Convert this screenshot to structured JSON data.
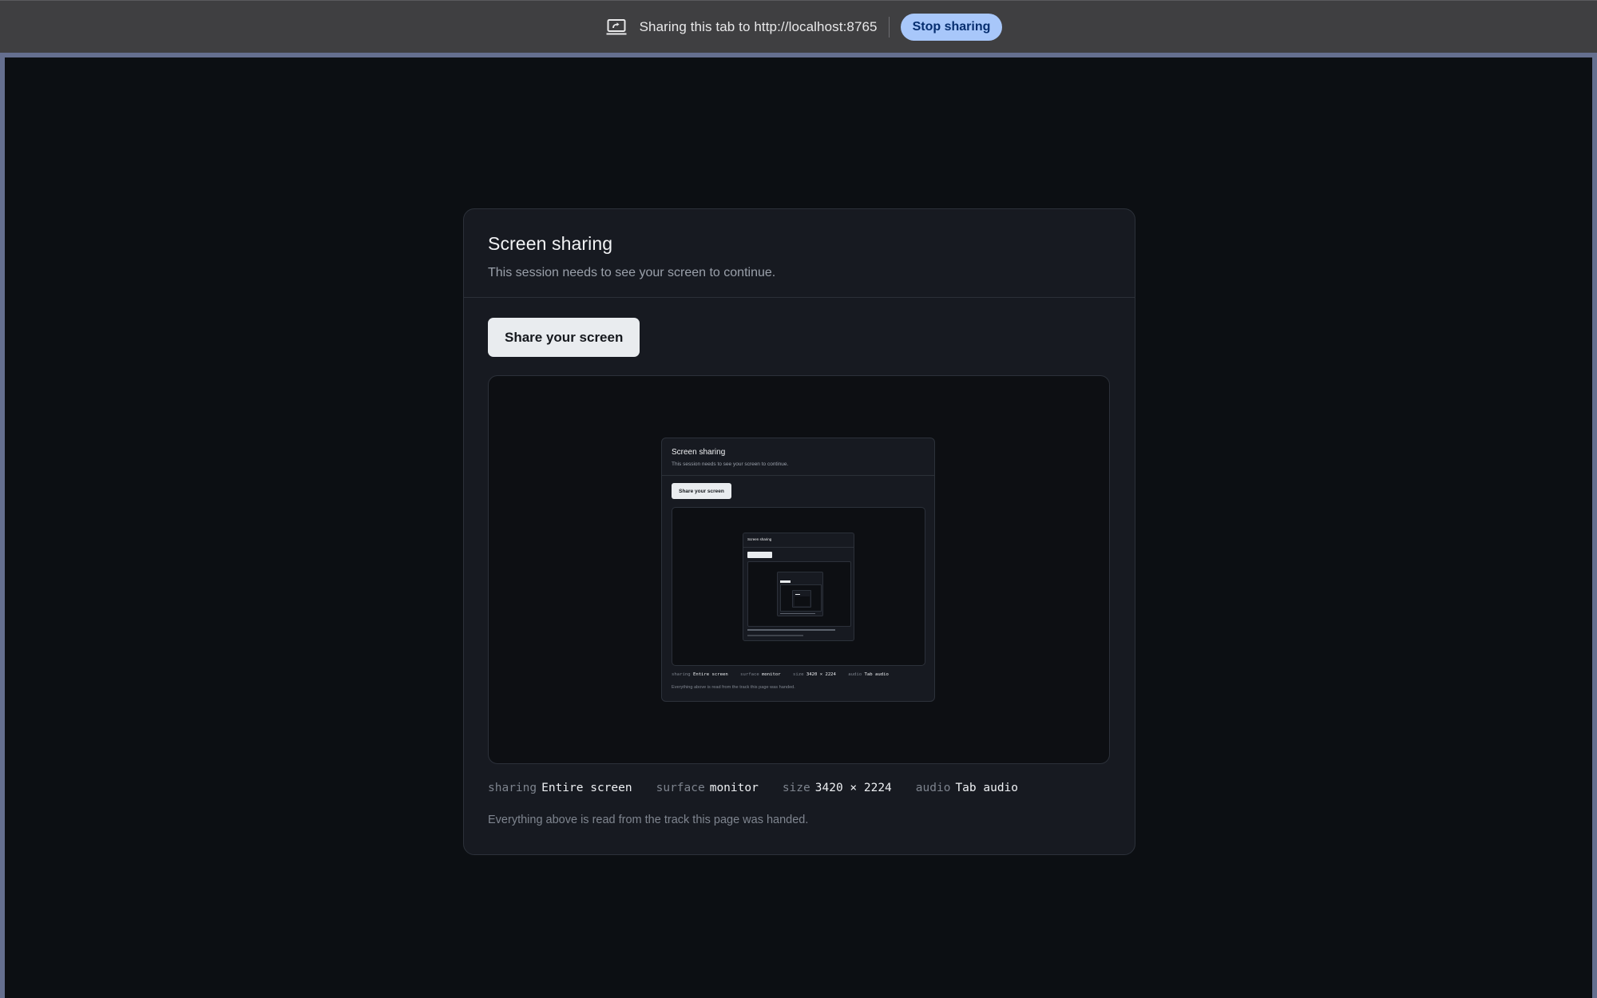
{
  "infobar": {
    "message": "Sharing this tab to http://localhost:8765",
    "stop_label": "Stop sharing",
    "icon": "screen-share-icon",
    "button_color": "#a8c7fa"
  },
  "card": {
    "title": "Screen sharing",
    "subtitle": "This session needs to see your screen to continue.",
    "share_button_label": "Share your screen",
    "meta": {
      "sharing_key": "sharing",
      "sharing_value": "Entire screen",
      "surface_key": "surface",
      "surface_value": "monitor",
      "size_key": "size",
      "size_value": "3420 × 2224",
      "audio_key": "audio",
      "audio_value": "Tab audio"
    },
    "note": "Everything above is read from the track this page was handed."
  },
  "preview": {
    "title": "Screen sharing",
    "subtitle": "This session needs to see your screen to continue.",
    "share_button_label": "Share your screen",
    "meta": {
      "sharing_key": "sharing",
      "sharing_value": "Entire screen",
      "surface_key": "surface",
      "surface_value": "monitor",
      "size_key": "size",
      "size_value": "3420 × 2224",
      "audio_key": "audio",
      "audio_value": "Tab audio"
    },
    "note": "Everything above is read from the track this page was handed."
  },
  "colors": {
    "page_background": "#0c0f13",
    "card_background": "#171a21",
    "tab_frame": "#656f8f",
    "infobar_background": "#3f3f41"
  }
}
